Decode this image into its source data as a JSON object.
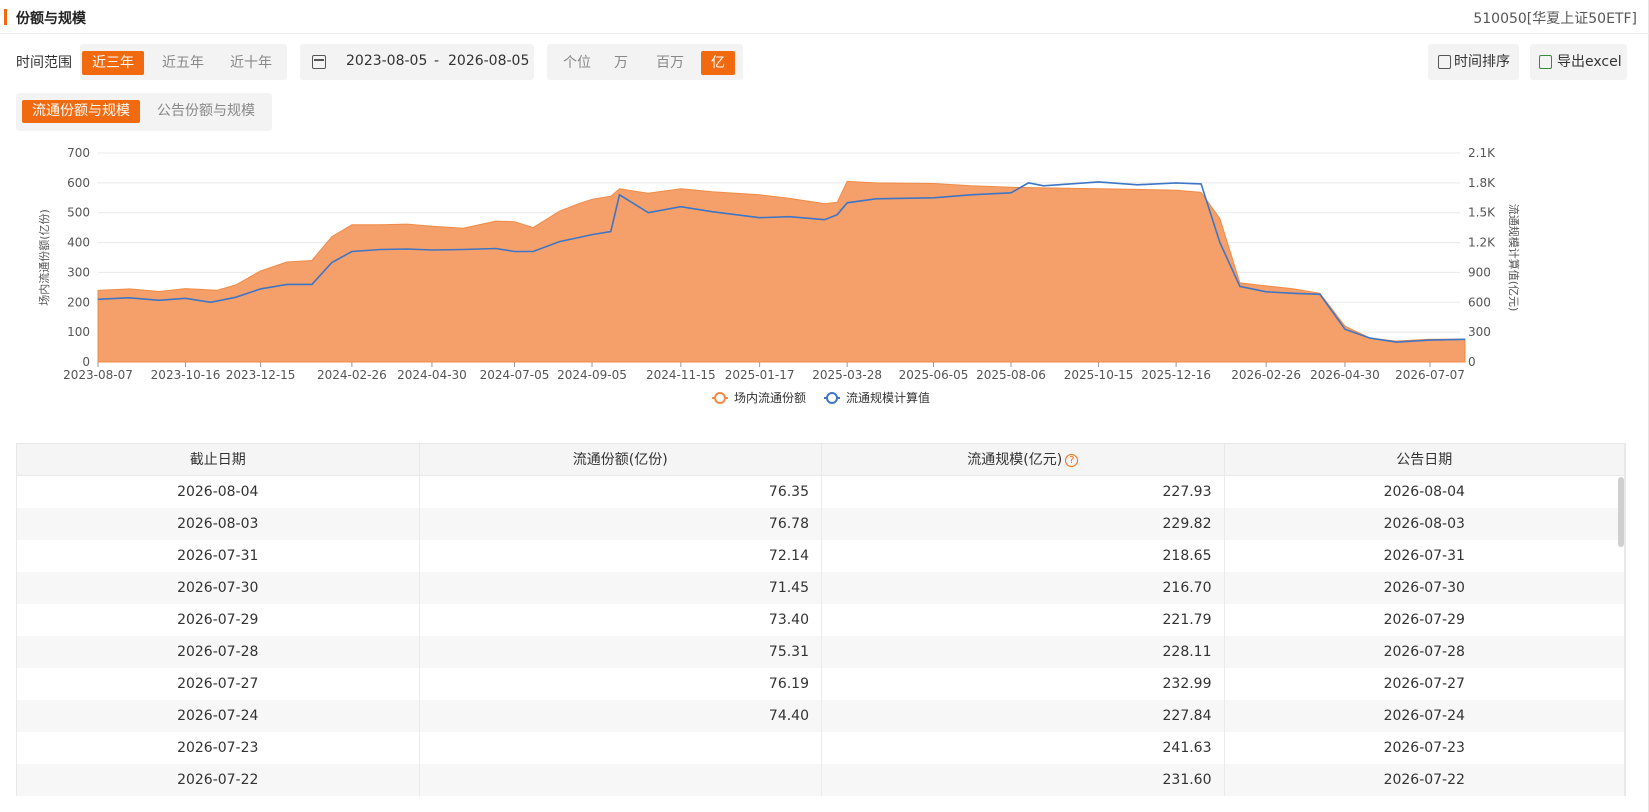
{
  "header": {
    "title": "份额与规模",
    "fund_name": "510050[华夏上证50ETF]"
  },
  "filters": {
    "time_range_label": "时间范围",
    "time_options": [
      "近三年",
      "近五年",
      "近十年"
    ],
    "time_selected": "近三年",
    "date_from": "2023-08-05",
    "date_sep": "-",
    "date_to": "2026-08-05",
    "unit_options": [
      "个位",
      "万",
      "百万",
      "亿"
    ],
    "unit_selected": "亿"
  },
  "actions": {
    "sort_label": "时间排序",
    "export_label": "导出excel"
  },
  "tabs": {
    "items": [
      "流通份额与规模",
      "公告份额与规模"
    ],
    "selected": "流通份额与规模"
  },
  "chart_data": {
    "type": "area",
    "x_ticks": [
      "2023-08-07",
      "2023-10-16",
      "2023-12-15",
      "2024-02-26",
      "2024-04-30",
      "2024-07-05",
      "2024-09-05",
      "2024-11-15",
      "2025-01-17",
      "2025-03-28",
      "2025-06-05",
      "2025-08-06",
      "2025-10-15",
      "2025-12-16",
      "2026-02-26",
      "2026-04-30",
      "2026-07-07"
    ],
    "ylabel_left": "场内流通份额(亿份)",
    "ylabel_right": "流通规模计算值(亿元)",
    "ylim_left": [
      0,
      700
    ],
    "ylim_right": [
      0,
      2100
    ],
    "y_ticks_left": [
      "700",
      "600",
      "500",
      "400",
      "300",
      "200",
      "100",
      "0"
    ],
    "y_ticks_right": [
      "2.1K",
      "1.8K",
      "1.5K",
      "1.2K",
      "900",
      "600",
      "300",
      "0"
    ],
    "legend_position": "bottom",
    "series": [
      {
        "name": "场内流通份额",
        "color": "#f5a06b",
        "axis": "left",
        "points": [
          [
            "2023-08-07",
            240
          ],
          [
            "2023-09-01",
            245
          ],
          [
            "2023-09-25",
            236
          ],
          [
            "2023-10-16",
            246
          ],
          [
            "2023-11-10",
            240
          ],
          [
            "2023-11-25",
            258
          ],
          [
            "2023-12-15",
            305
          ],
          [
            "2024-01-05",
            335
          ],
          [
            "2024-01-25",
            340
          ],
          [
            "2024-02-10",
            420
          ],
          [
            "2024-02-26",
            460
          ],
          [
            "2024-03-20",
            460
          ],
          [
            "2024-04-10",
            462
          ],
          [
            "2024-04-30",
            455
          ],
          [
            "2024-05-25",
            448
          ],
          [
            "2024-06-20",
            472
          ],
          [
            "2024-07-05",
            470
          ],
          [
            "2024-07-20",
            450
          ],
          [
            "2024-08-10",
            505
          ],
          [
            "2024-08-25",
            530
          ],
          [
            "2024-09-05",
            545
          ],
          [
            "2024-09-20",
            555
          ],
          [
            "2024-09-27",
            580
          ],
          [
            "2024-10-20",
            565
          ],
          [
            "2024-11-15",
            580
          ],
          [
            "2024-12-10",
            570
          ],
          [
            "2025-01-17",
            560
          ],
          [
            "2025-02-10",
            548
          ],
          [
            "2025-03-10",
            530
          ],
          [
            "2025-03-20",
            535
          ],
          [
            "2025-03-28",
            605
          ],
          [
            "2025-04-20",
            600
          ],
          [
            "2025-06-05",
            598
          ],
          [
            "2025-07-05",
            590
          ],
          [
            "2025-08-06",
            585
          ],
          [
            "2025-09-01",
            583
          ],
          [
            "2025-10-15",
            580
          ],
          [
            "2025-11-15",
            578
          ],
          [
            "2025-12-16",
            575
          ],
          [
            "2026-01-05",
            568
          ],
          [
            "2026-01-20",
            480
          ],
          [
            "2026-02-05",
            265
          ],
          [
            "2026-02-26",
            255
          ],
          [
            "2026-03-20",
            245
          ],
          [
            "2026-04-10",
            230
          ],
          [
            "2026-04-30",
            120
          ],
          [
            "2026-05-20",
            80
          ],
          [
            "2026-06-10",
            70
          ],
          [
            "2026-07-07",
            76
          ],
          [
            "2026-08-04",
            76
          ]
        ]
      },
      {
        "name": "流通规模计算值",
        "color": "#3e76c5",
        "axis": "right",
        "points": [
          [
            "2023-08-07",
            630
          ],
          [
            "2023-09-01",
            645
          ],
          [
            "2023-09-25",
            620
          ],
          [
            "2023-10-16",
            640
          ],
          [
            "2023-11-05",
            600
          ],
          [
            "2023-11-25",
            650
          ],
          [
            "2023-12-15",
            735
          ],
          [
            "2024-01-05",
            780
          ],
          [
            "2024-01-25",
            780
          ],
          [
            "2024-02-10",
            1000
          ],
          [
            "2024-02-26",
            1110
          ],
          [
            "2024-03-20",
            1130
          ],
          [
            "2024-04-10",
            1135
          ],
          [
            "2024-04-30",
            1125
          ],
          [
            "2024-05-25",
            1130
          ],
          [
            "2024-06-20",
            1140
          ],
          [
            "2024-07-05",
            1110
          ],
          [
            "2024-07-20",
            1110
          ],
          [
            "2024-08-10",
            1210
          ],
          [
            "2024-08-25",
            1250
          ],
          [
            "2024-09-05",
            1280
          ],
          [
            "2024-09-20",
            1310
          ],
          [
            "2024-09-27",
            1680
          ],
          [
            "2024-10-20",
            1500
          ],
          [
            "2024-11-15",
            1560
          ],
          [
            "2024-12-10",
            1510
          ],
          [
            "2025-01-17",
            1450
          ],
          [
            "2025-02-10",
            1460
          ],
          [
            "2025-03-10",
            1430
          ],
          [
            "2025-03-20",
            1480
          ],
          [
            "2025-03-28",
            1600
          ],
          [
            "2025-04-20",
            1640
          ],
          [
            "2025-06-05",
            1650
          ],
          [
            "2025-07-05",
            1680
          ],
          [
            "2025-08-06",
            1700
          ],
          [
            "2025-08-20",
            1800
          ],
          [
            "2025-09-01",
            1770
          ],
          [
            "2025-10-15",
            1810
          ],
          [
            "2025-11-15",
            1780
          ],
          [
            "2025-12-16",
            1800
          ],
          [
            "2026-01-05",
            1790
          ],
          [
            "2026-01-20",
            1200
          ],
          [
            "2026-02-05",
            760
          ],
          [
            "2026-02-26",
            705
          ],
          [
            "2026-03-20",
            690
          ],
          [
            "2026-04-10",
            680
          ],
          [
            "2026-04-30",
            330
          ],
          [
            "2026-05-20",
            240
          ],
          [
            "2026-06-10",
            200
          ],
          [
            "2026-07-07",
            220
          ],
          [
            "2026-08-04",
            228
          ]
        ]
      }
    ]
  },
  "table": {
    "columns": [
      "截止日期",
      "流通份额(亿份)",
      "流通规模(亿元)",
      "公告日期"
    ],
    "rows": [
      [
        "2026-08-04",
        "76.35",
        "227.93",
        "2026-08-04"
      ],
      [
        "2026-08-03",
        "76.78",
        "229.82",
        "2026-08-03"
      ],
      [
        "2026-07-31",
        "72.14",
        "218.65",
        "2026-07-31"
      ],
      [
        "2026-07-30",
        "71.45",
        "216.70",
        "2026-07-30"
      ],
      [
        "2026-07-29",
        "73.40",
        "221.79",
        "2026-07-29"
      ],
      [
        "2026-07-28",
        "75.31",
        "228.11",
        "2026-07-28"
      ],
      [
        "2026-07-27",
        "76.19",
        "232.99",
        "2026-07-27"
      ],
      [
        "2026-07-24",
        "74.40",
        "227.84",
        "2026-07-24"
      ],
      [
        "2026-07-23",
        "",
        "241.63",
        "2026-07-23"
      ],
      [
        "2026-07-22",
        "",
        "231.60",
        "2026-07-22"
      ]
    ]
  }
}
